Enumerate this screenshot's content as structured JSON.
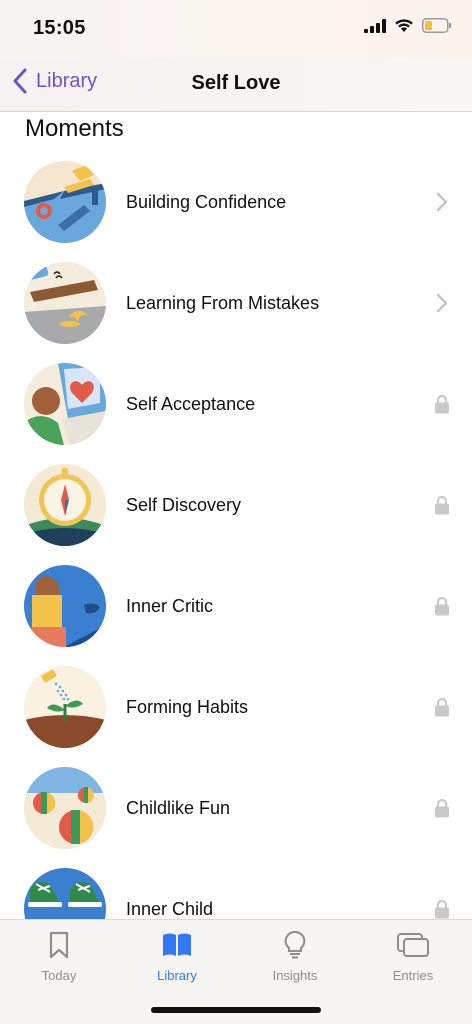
{
  "status": {
    "time": "15:05"
  },
  "nav": {
    "back_label": "Library",
    "title": "Self Love"
  },
  "section": {
    "title": "Moments"
  },
  "items": [
    {
      "label": "Building Confidence",
      "trail": "chevron"
    },
    {
      "label": "Learning From Mistakes",
      "trail": "chevron"
    },
    {
      "label": "Self Acceptance",
      "trail": "lock"
    },
    {
      "label": "Self Discovery",
      "trail": "lock"
    },
    {
      "label": "Inner Critic",
      "trail": "lock"
    },
    {
      "label": "Forming Habits",
      "trail": "lock"
    },
    {
      "label": "Childlike Fun",
      "trail": "lock"
    },
    {
      "label": "Inner Child",
      "trail": "lock"
    }
  ],
  "tabs": [
    {
      "label": "Today",
      "icon": "bookmark-icon",
      "active": false
    },
    {
      "label": "Library",
      "icon": "book-icon",
      "active": true
    },
    {
      "label": "Insights",
      "icon": "lightbulb-icon",
      "active": false
    },
    {
      "label": "Entries",
      "icon": "entries-icon",
      "active": false
    }
  ],
  "colors": {
    "accent_back": "#6a54c8",
    "accent_tab": "#3478f6",
    "lock": "#c9c9c9"
  }
}
